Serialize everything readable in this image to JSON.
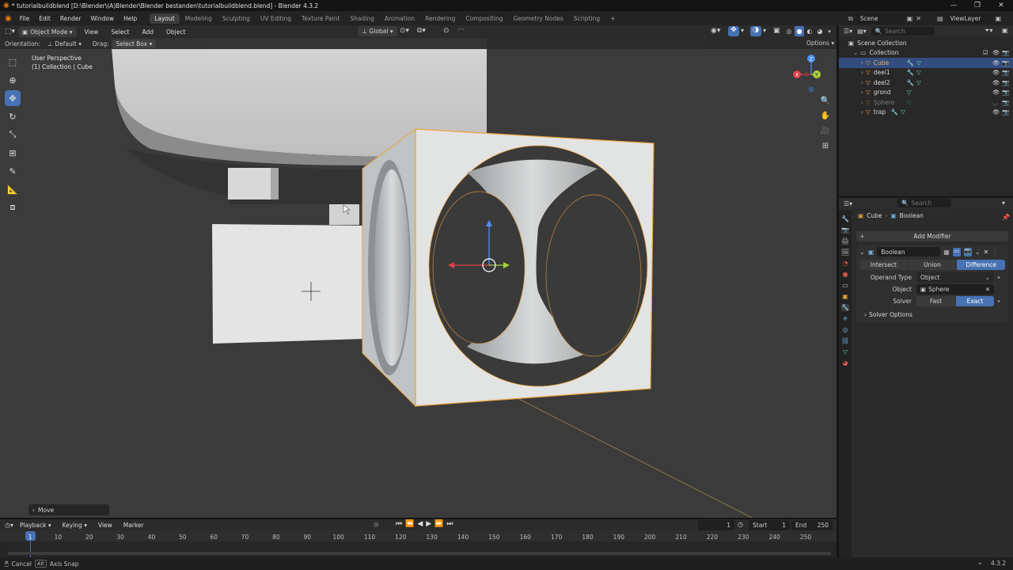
{
  "title": "* tutorialbuildblend [D:\\Blender\\(A)Blender\\Blender bestanden\\tutorialbuildblend.blend] - Blender 4.3.2",
  "menu": [
    "File",
    "Edit",
    "Render",
    "Window",
    "Help"
  ],
  "workspaces": [
    "Layout",
    "Modeling",
    "Sculpting",
    "UV Editing",
    "Texture Paint",
    "Shading",
    "Animation",
    "Rendering",
    "Compositing",
    "Geometry Nodes",
    "Scripting"
  ],
  "active_workspace": "Layout",
  "scene": {
    "label": "Scene",
    "viewlayer": "ViewLayer"
  },
  "viewport_header": {
    "mode": "Object Mode",
    "menus": [
      "View",
      "Select",
      "Add",
      "Object"
    ],
    "transform": "Global",
    "orientation_label": "Orientation:",
    "orientation_value": "Default",
    "drag_label": "Drag:",
    "drag_value": "Select Box",
    "options": "Options"
  },
  "viewport": {
    "perspective": "User Perspective",
    "collection_info": "(1) Collection | Cube",
    "last_op": "Move"
  },
  "outliner": {
    "search_placeholder": "Search",
    "root": "Scene Collection",
    "collection": "Collection",
    "objects": [
      {
        "name": "Cube",
        "selected": true
      },
      {
        "name": "deel1",
        "selected": false
      },
      {
        "name": "deel2",
        "selected": false
      },
      {
        "name": "grond",
        "selected": false
      },
      {
        "name": "Sphere",
        "selected": false,
        "hidden": true
      },
      {
        "name": "trap",
        "selected": false
      }
    ]
  },
  "properties": {
    "search_placeholder": "Search",
    "breadcrumb_object": "Cube",
    "breadcrumb_modifier": "Boolean",
    "add_modifier": "Add Modifier",
    "modifier_name": "Boolean",
    "ops": [
      "Intersect",
      "Union",
      "Difference"
    ],
    "active_op": "Difference",
    "operand_type_label": "Operand Type",
    "operand_type_value": "Object",
    "object_label": "Object",
    "object_value": "Sphere",
    "solver_label": "Solver",
    "solver_options": [
      "Fast",
      "Exact"
    ],
    "active_solver": "Exact",
    "solver_options_panel": "Solver Options"
  },
  "timeline": {
    "menus": [
      "Playback",
      "Keying",
      "View",
      "Marker"
    ],
    "current_frame": "1",
    "start_label": "Start",
    "start": "1",
    "end_label": "End",
    "end": "250",
    "ticks": [
      "1",
      "10",
      "20",
      "30",
      "40",
      "50",
      "60",
      "70",
      "80",
      "90",
      "100",
      "110",
      "120",
      "130",
      "140",
      "150",
      "160",
      "170",
      "180",
      "190",
      "200",
      "210",
      "220",
      "230",
      "240",
      "250"
    ]
  },
  "statusbar": {
    "cancel": "Cancel",
    "axis_snap": "Axis Snap",
    "version": "4.3.2"
  },
  "colors": {
    "accent": "#4772b3",
    "selection_outline": "#e8a23a",
    "orange_object": "#e8a23a"
  }
}
